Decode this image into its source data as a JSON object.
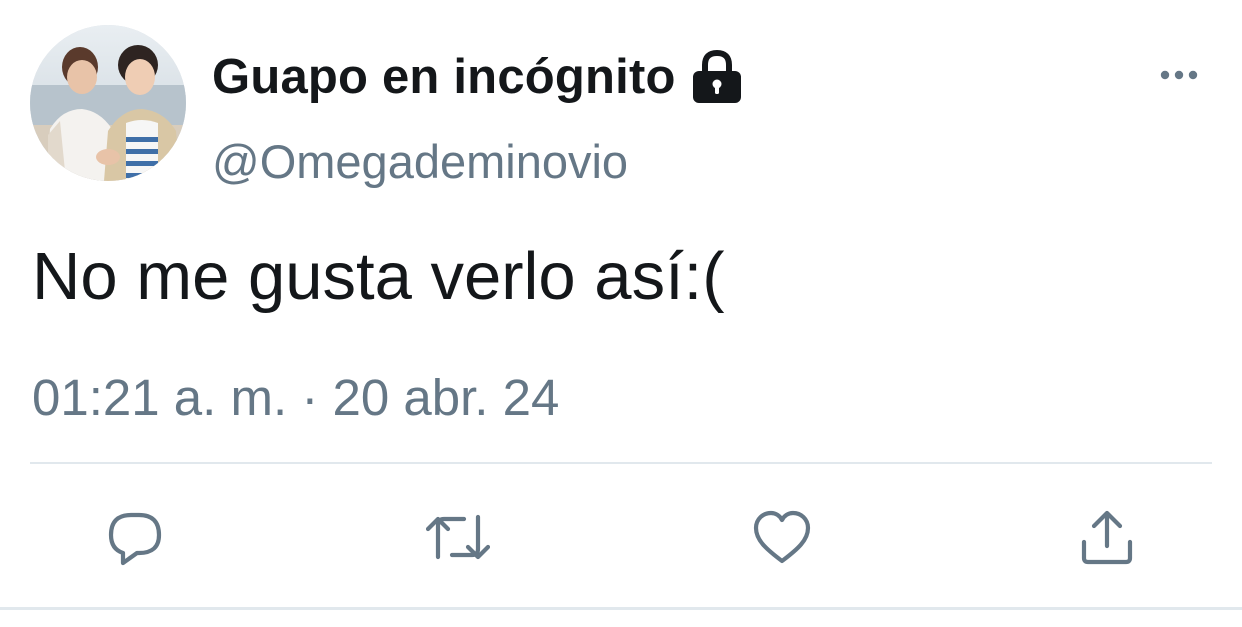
{
  "tweet": {
    "author": {
      "display_name": "Guapo en incógnito",
      "handle": "@Omegademinovio",
      "avatar_icon": "user-avatar",
      "protected_icon": "lock-icon"
    },
    "text": "No me gusta verlo así:(",
    "timestamp": "01:21 a. m. · 20 abr. 24",
    "menu_icon": "more-icon",
    "actions": [
      {
        "name": "reply",
        "icon": "reply-icon"
      },
      {
        "name": "retweet",
        "icon": "retweet-icon"
      },
      {
        "name": "like",
        "icon": "heart-icon"
      },
      {
        "name": "share",
        "icon": "share-icon"
      }
    ]
  },
  "colors": {
    "text_primary": "#14171a",
    "text_secondary": "#657786",
    "divider": "#e1e8ed",
    "icon": "#657786"
  }
}
